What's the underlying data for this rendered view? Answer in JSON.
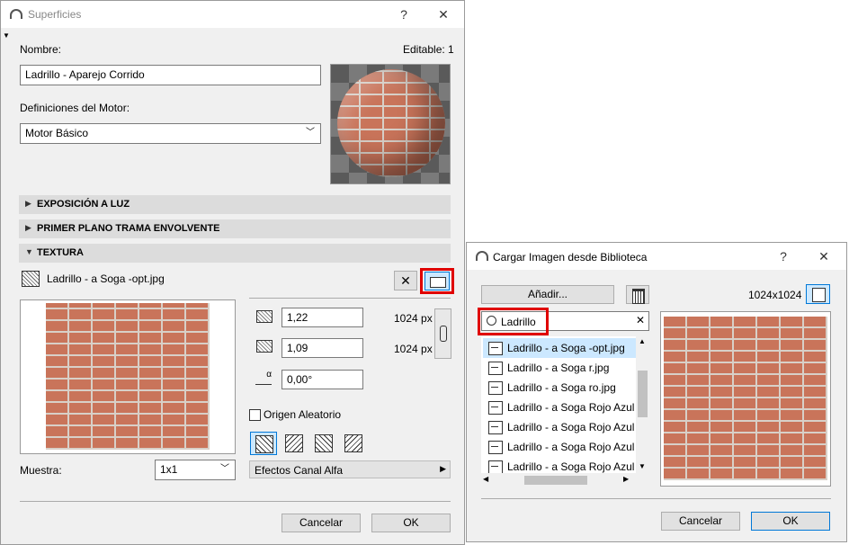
{
  "surfaces": {
    "title": "Superficies",
    "help": "?",
    "close": "✕",
    "name_label": "Nombre:",
    "editable": "Editable: 1",
    "name_value": "Ladrillo - Aparejo Corrido",
    "engine_label": "Definiciones del Motor:",
    "engine_value": "Motor Básico",
    "sections": {
      "light": "EXPOSICIÓN A LUZ",
      "fill": "PRIMER PLANO TRAMA ENVOLVENTE",
      "texture": "TEXTURA"
    },
    "texture_file": "Ladrillo - a Soga -opt.jpg",
    "width_value": "1,22",
    "width_px": "1024 px",
    "height_value": "1,09",
    "height_px": "1024 px",
    "angle_value": "0,00°",
    "random_origin": "Origen Aleatorio",
    "sample_label": "Muestra:",
    "sample_value": "1x1",
    "alpha_effects": "Efectos Canal Alfa",
    "cancel": "Cancelar",
    "ok": "OK"
  },
  "library": {
    "title": "Cargar Imagen desde Biblioteca",
    "help": "?",
    "close": "✕",
    "add_button": "Añadir...",
    "resolution": "1024x1024",
    "search_value": "Ladrillo",
    "items": [
      "Ladrillo - a Soga -opt.jpg",
      "Ladrillo - a Soga r.jpg",
      "Ladrillo - a Soga ro.jpg",
      "Ladrillo - a Soga Rojo Azul D",
      "Ladrillo - a Soga Rojo Azul D",
      "Ladrillo - a Soga Rojo Azul D",
      "Ladrillo - a Soga Rojo Azul D"
    ],
    "cancel": "Cancelar",
    "ok": "OK"
  },
  "colors": {
    "highlight_red": "#e00000",
    "selection_blue": "#cce8ff",
    "brick": "#c9745a"
  }
}
